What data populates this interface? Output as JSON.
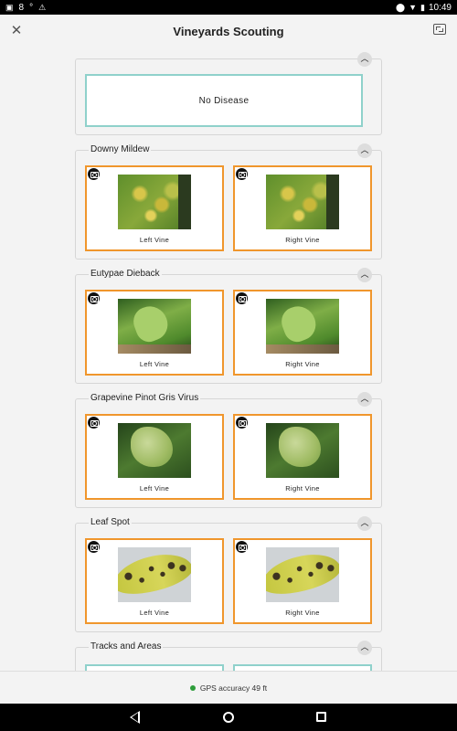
{
  "status_bar": {
    "notification_count": "8",
    "temperature_unit": "°",
    "time": "10:49"
  },
  "header": {
    "title": "Vineyards Scouting",
    "close_icon": "close-icon",
    "expand_icon": "expand-icon"
  },
  "sections": {
    "no_disease": {
      "label": "No Disease"
    },
    "downy_mildew": {
      "title": "Downy Mildew",
      "left_label": "Left Vine",
      "right_label": "Right Vine"
    },
    "eutypae_dieback": {
      "title": "Eutypae Dieback",
      "left_label": "Left Vine",
      "right_label": "Right Vine"
    },
    "pinot_gris": {
      "title": "Grapevine Pinot Gris Virus",
      "left_label": "Left Vine",
      "right_label": "Right Vine"
    },
    "leaf_spot": {
      "title": "Leaf Spot",
      "left_label": "Left Vine",
      "right_label": "Right Vine"
    },
    "tracks": {
      "title": "Tracks and Areas"
    }
  },
  "gps": {
    "text": "GPS accuracy 49 ft",
    "status_color": "#2e9d3a"
  },
  "colors": {
    "card_border": "#f0962c",
    "no_disease_border": "#8fd1cb"
  }
}
